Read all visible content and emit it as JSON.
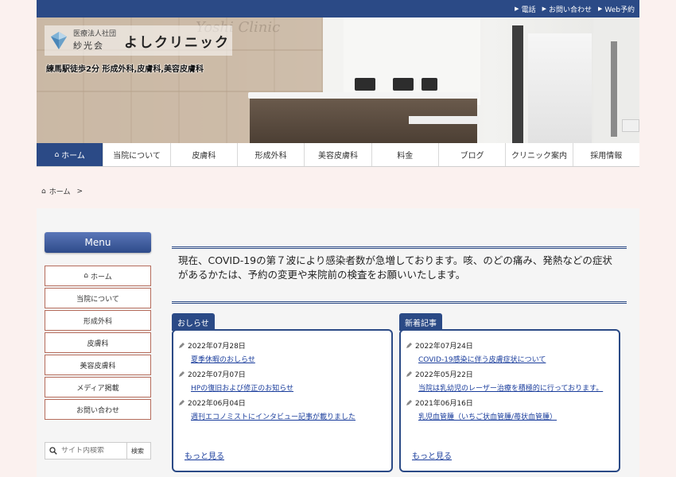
{
  "topbar": {
    "links": [
      "電話",
      "お問い合わせ",
      "Web予約"
    ]
  },
  "header": {
    "corp_line1": "医療法人社団",
    "corp_line2": "紗光会",
    "clinic_name": "よしクリニック",
    "wall_sign": "Yoshi Clinic",
    "tagline": "練馬駅徒歩2分 形成外科,皮膚科,美容皮膚科"
  },
  "nav": {
    "items": [
      "ホーム",
      "当院について",
      "皮膚科",
      "形成外科",
      "美容皮膚科",
      "料金",
      "ブログ",
      "クリニック案内",
      "採用情報"
    ]
  },
  "breadcrumb": {
    "home": "ホーム",
    "sep": ">"
  },
  "sidebar": {
    "menu_title": "Menu",
    "items": [
      "ホーム",
      "当院について",
      "形成外科",
      "皮膚科",
      "美容皮膚科",
      "メディア掲載",
      "お問い合わせ"
    ],
    "search_placeholder": "サイト内検索",
    "search_button": "検索"
  },
  "notice": {
    "text": "現在、COVID-19の第７波により感染者数が急増しております。咳、のどの痛み、発熱などの症状があるかたは、予約の変更や来院前の検査をお願いいたします。"
  },
  "news": {
    "label": "おしらせ",
    "entries": [
      {
        "date": "2022年07月28日",
        "title": "夏季休暇のおしらせ"
      },
      {
        "date": "2022年07月07日",
        "title": "HPの復旧および修正のお知らせ"
      },
      {
        "date": "2022年06月04日",
        "title": "週刊エコノミストにインタビュー記事が載りました"
      }
    ],
    "more": "もっと見る"
  },
  "latest": {
    "label": "新着記事",
    "entries": [
      {
        "date": "2022年07月24日",
        "title": "COVID-19感染に伴う皮膚症状について"
      },
      {
        "date": "2022年05月22日",
        "title": "当院は乳幼児のレーザー治療を積極的に行っております。"
      },
      {
        "date": "2021年06月16日",
        "title": "乳児血管腫（いちご状血管腫/苺状血管腫）"
      }
    ],
    "more": "もっと見る"
  },
  "colors": {
    "brand": "#2b4a86",
    "link": "#1a3d9c",
    "sidebar_border": "#b56c5c",
    "background": "#fbf1ef"
  },
  "icons": {
    "home": "home-icon",
    "search": "search-icon",
    "pen": "pen-icon",
    "triangle": "triangle-right-icon"
  }
}
